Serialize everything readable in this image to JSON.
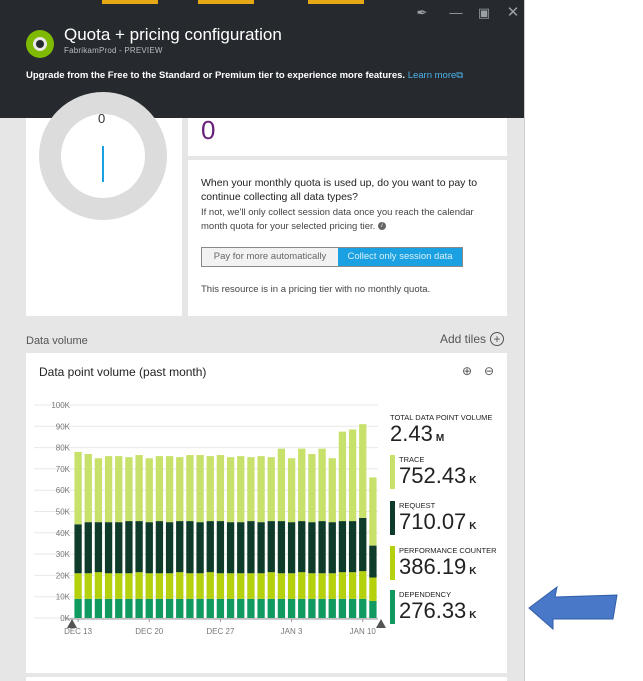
{
  "header": {
    "title": "Quota + pricing configuration",
    "subtitle": "FabrikamProd - PREVIEW",
    "banner_text": "Upgrade from the Free to the Standard or Premium tier to experience more features.",
    "learn_more": "Learn more"
  },
  "window_controls": {
    "pin": "pin-icon",
    "minimize": "minimize-icon",
    "maximize": "maximize-icon",
    "close": "close-icon"
  },
  "donut": {
    "value": "0"
  },
  "usage": {
    "value": "0"
  },
  "quota_question": {
    "text": "When your monthly quota is used up, do you want to pay to continue collecting all data types?",
    "note": "If not, we'll only collect session data once you reach the calendar month quota for your selected pricing tier.",
    "option_pay": "Pay for more automatically",
    "option_collect": "Collect only session data",
    "selected": "Collect only session data",
    "tier_note": "This resource is in a pricing tier with no monthly quota."
  },
  "section": {
    "label": "Data volume",
    "add_tiles": "Add tiles"
  },
  "chart_tile": {
    "title": "Data point volume (past month)",
    "zoom_in": "zoom-in-icon",
    "zoom_out": "zoom-out-icon"
  },
  "metrics": [
    {
      "name": "TOTAL DATA POINT VOLUME",
      "value": "2.43",
      "unit": "M",
      "color": ""
    },
    {
      "name": "TRACE",
      "value": "752.43",
      "unit": "K",
      "color": "#c7e16b"
    },
    {
      "name": "REQUEST",
      "value": "710.07",
      "unit": "K",
      "color": "#0e3b2a"
    },
    {
      "name": "PERFORMANCE COUNTER",
      "value": "386.19",
      "unit": "K",
      "color": "#b5d10d"
    },
    {
      "name": "DEPENDENCY",
      "value": "276.33",
      "unit": "K",
      "color": "#109a60"
    }
  ],
  "chart_data": {
    "type": "bar",
    "stacked": true,
    "y_ticks": [
      "0K",
      "10K",
      "20K",
      "30K",
      "40K",
      "50K",
      "60K",
      "70K",
      "80K",
      "90K",
      "100K"
    ],
    "ylim": [
      0,
      100000
    ],
    "x_tick_labels": [
      "DEC 13",
      "DEC 20",
      "DEC 27",
      "JAN 3",
      "JAN 10"
    ],
    "x_tick_index": [
      0,
      7,
      14,
      21,
      28
    ],
    "grid": true,
    "legend_position": "right",
    "series": [
      {
        "name": "DEPENDENCY",
        "color": "#109a60",
        "values": [
          9000,
          9000,
          9000,
          9000,
          9000,
          9000,
          9000,
          9000,
          9000,
          9000,
          9000,
          9000,
          9000,
          9000,
          9000,
          9000,
          9000,
          9000,
          9000,
          9000,
          9000,
          9000,
          9000,
          9000,
          9000,
          9000,
          9000,
          9000,
          9000,
          8000
        ]
      },
      {
        "name": "PERFORMANCE COUNTER",
        "color": "#b5d10d",
        "values": [
          12000,
          12000,
          12500,
          12000,
          12000,
          12000,
          12500,
          12000,
          12000,
          12000,
          12500,
          12000,
          12000,
          12500,
          12000,
          12000,
          12000,
          12000,
          12000,
          12500,
          12000,
          12000,
          12500,
          12000,
          12000,
          12000,
          12500,
          12500,
          13000,
          11000
        ]
      },
      {
        "name": "REQUEST",
        "color": "#0e3b2a",
        "values": [
          23000,
          24000,
          23500,
          24000,
          24000,
          24500,
          24000,
          24000,
          24500,
          24000,
          24000,
          24500,
          24000,
          24000,
          24500,
          24000,
          24000,
          24500,
          24000,
          24000,
          24500,
          24000,
          24000,
          24000,
          24500,
          24000,
          24000,
          24000,
          25000,
          15000
        ]
      },
      {
        "name": "TRACE",
        "color": "#c7e16b",
        "values": [
          34000,
          32000,
          30000,
          31000,
          31000,
          30000,
          31000,
          30000,
          30500,
          31000,
          30000,
          31000,
          31500,
          30500,
          31000,
          30500,
          31000,
          30000,
          31000,
          30000,
          34000,
          30000,
          34000,
          32000,
          34000,
          30000,
          42000,
          43000,
          44000,
          32000
        ]
      }
    ]
  }
}
